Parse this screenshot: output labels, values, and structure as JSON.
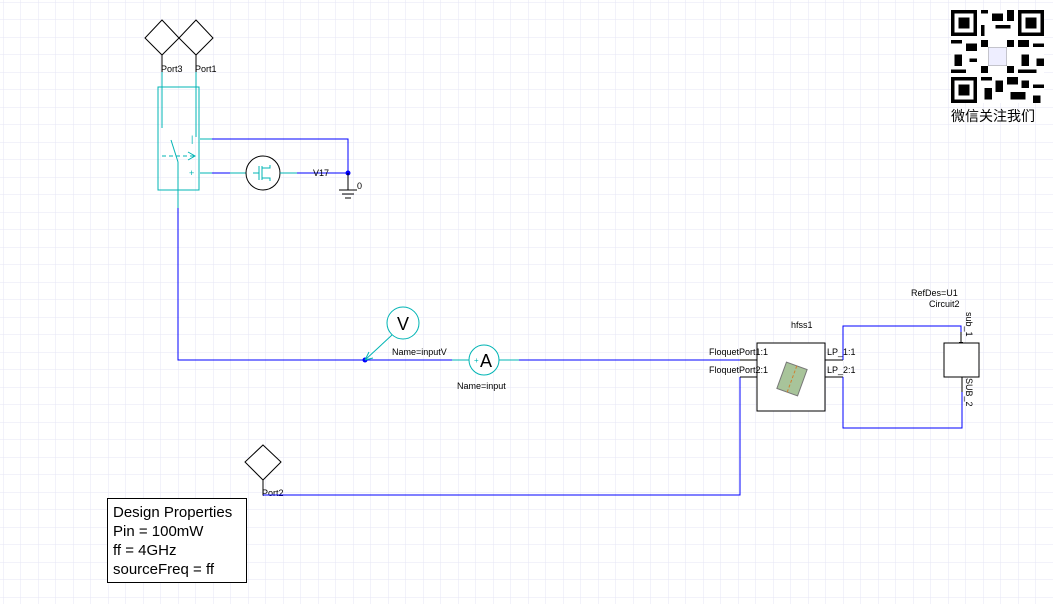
{
  "colors": {
    "wire": "#0000ff",
    "component": "#00b4b4",
    "grid": "#e6e6f4",
    "node": "#0000ff"
  },
  "ports": {
    "port3": "Port3",
    "port1": "Port1",
    "port2": "Port2"
  },
  "source": {
    "label": "V17",
    "ground": "0"
  },
  "meters": {
    "voltmeter_symbol": "V",
    "voltmeter_name": "Name=inputV",
    "ammeter_symbol": "A",
    "ammeter_name": "Name=input"
  },
  "hfss": {
    "title": "hfss1",
    "port1": "FloquetPort1:1",
    "port2": "FloquetPort2:1",
    "lp1": "LP_1:1",
    "lp2": "LP_2:1"
  },
  "subcircuit": {
    "refdes": "RefDes=U1",
    "name": "Circuit2",
    "pin1": "sub_1",
    "pin2": "SUB_2"
  },
  "design_properties": {
    "title": "Design Properties",
    "lines": [
      "Pin = 100mW",
      "ff = 4GHz",
      "sourceFreq = ff"
    ]
  },
  "qr": {
    "caption": "微信关注我们",
    "icon": "qr-code"
  }
}
